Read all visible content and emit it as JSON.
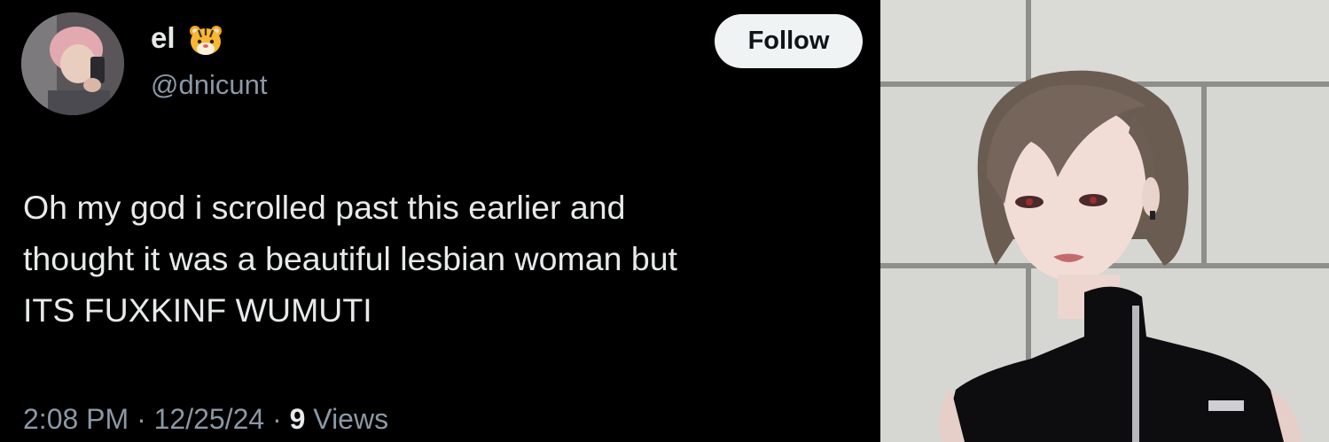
{
  "tweet": {
    "display_name": "el",
    "name_emoji": "tiger-face-emoji",
    "handle": "@dnicunt",
    "follow_label": "Follow",
    "text_lines": [
      "Oh my god i scrolled past this earlier and",
      "thought it was a beautiful lesbian woman but",
      "ITS FUXKINF WUMUTI"
    ],
    "time": "2:08 PM",
    "date": "12/25/24",
    "sep": "·",
    "views_count": "9",
    "views_label": "Views"
  },
  "colors": {
    "background": "#000000",
    "primary_text": "#e7e9ea",
    "secondary_text": "#8b98a5",
    "follow_bg": "#eff3f4",
    "follow_text": "#0f1419"
  }
}
